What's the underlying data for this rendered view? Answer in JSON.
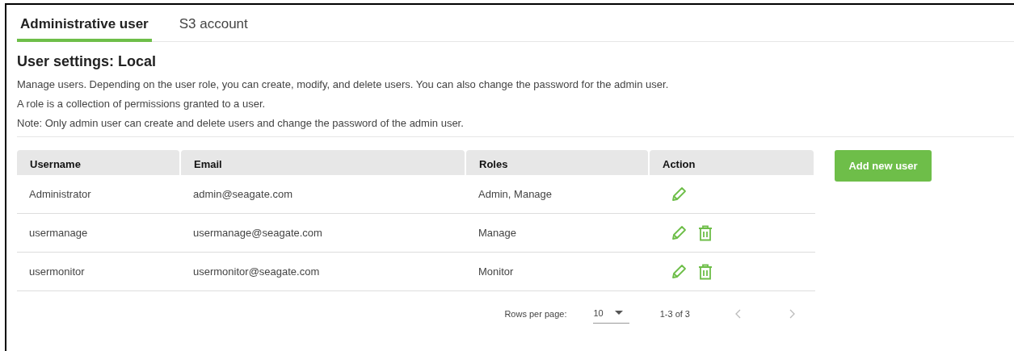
{
  "tabs": [
    {
      "label": "Administrative user",
      "selected": true
    },
    {
      "label": "S3 account",
      "selected": false
    }
  ],
  "heading": "User settings: Local",
  "paragraphs": [
    "Manage users. Depending on the user role, you can create, modify, and delete users. You can also change the password for the admin user.",
    "A role is a collection of permissions granted to a user.",
    "Note: Only admin user can create and delete users and change the password of the admin user."
  ],
  "table": {
    "columns": [
      "Username",
      "Email",
      "Roles",
      "Action"
    ],
    "rows": [
      {
        "username": "Administrator",
        "email": "admin@seagate.com",
        "roles": "Admin, Manage",
        "editable": true,
        "deletable": false
      },
      {
        "username": "usermanage",
        "email": "usermanage@seagate.com",
        "roles": "Manage",
        "editable": true,
        "deletable": true
      },
      {
        "username": "usermonitor",
        "email": "usermonitor@seagate.com",
        "roles": "Monitor",
        "editable": true,
        "deletable": true
      }
    ]
  },
  "pagination": {
    "rows_per_page_label": "Rows per page:",
    "rows_per_page": "10",
    "range": "1-3 of 3",
    "prev_disabled": true,
    "next_disabled": true
  },
  "add_button": "Add new user"
}
